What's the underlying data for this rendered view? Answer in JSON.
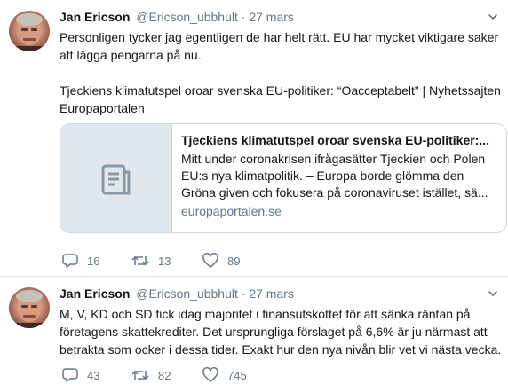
{
  "tweets": [
    {
      "author": {
        "name": "Jan Ericson",
        "handle": "@Ericson_ubbhult",
        "date": "27 mars"
      },
      "text_1": "Personligen tycker jag egentligen de har helt rätt. EU har mycket viktigare saker att lägga pengarna på nu.",
      "text_2": "Tjeckiens klimatutspel oroar svenska EU-politiker: “Oacceptabelt” | Nyhetssajten Europaportalen",
      "card": {
        "title": "Tjeckiens klimatutspel oroar svenska EU-politiker:...",
        "description": "Mitt under coronakrisen ifrågasätter Tjeckien och Polen EU:s nya klimatpolitik. – Europa borde glömma den Gröna given och fokusera på coronaviruset istället, sä...",
        "domain": "europaportalen.se"
      },
      "stats": {
        "replies": "16",
        "retweets": "13",
        "likes": "89"
      }
    },
    {
      "author": {
        "name": "Jan Ericson",
        "handle": "@Ericson_ubbhult",
        "date": "27 mars"
      },
      "text_1": "M, V, KD och SD fick idag majoritet i finansutskottet för att sänka räntan på företagens skattekrediter. Det ursprungliga förslaget på 6,6% är ju närmast att betrakta som ocker i dessa tider. Exakt hur den nya nivån blir vet vi nästa vecka.",
      "stats": {
        "replies": "43",
        "retweets": "82",
        "likes": "745"
      }
    }
  ],
  "separator": "·",
  "icons": {
    "reply": "reply-icon",
    "retweet": "retweet-icon",
    "like": "heart-icon",
    "more": "chevron-down-icon",
    "card": "document-icon"
  },
  "colors": {
    "muted": "#657786",
    "border": "#e6ecf0",
    "card_bg": "#e1e8ed"
  }
}
